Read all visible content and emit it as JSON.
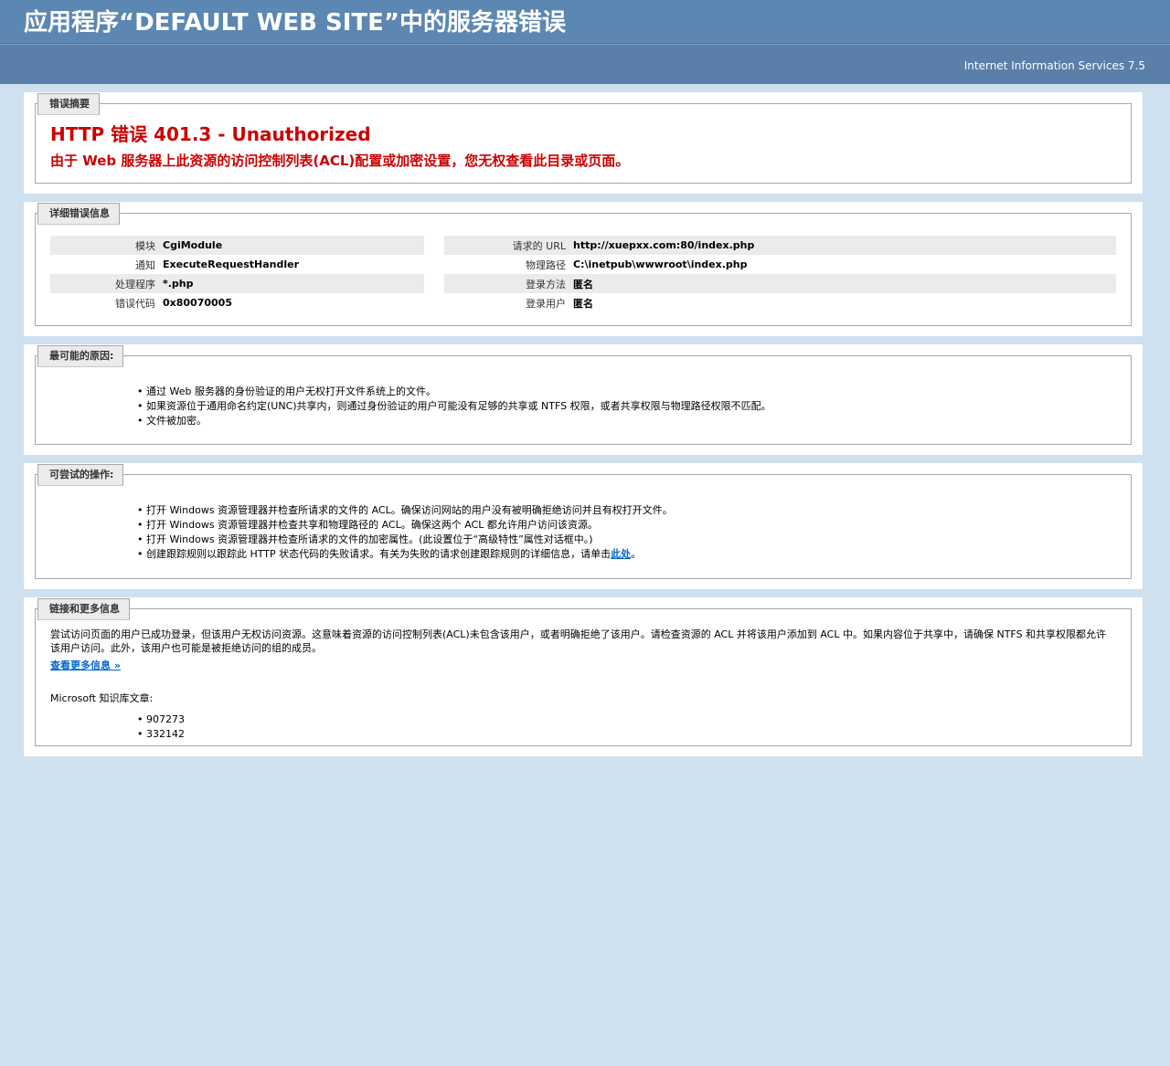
{
  "header": {
    "title": "应用程序“DEFAULT WEB SITE”中的服务器错误",
    "server": "Internet Information Services 7.5"
  },
  "summary": {
    "legend": "错误摘要",
    "title": "HTTP 错误 401.3 - Unauthorized",
    "description": "由于 Web 服务器上此资源的访问控制列表(ACL)配置或加密设置，您无权查看此目录或页面。"
  },
  "details": {
    "legend": "详细错误信息",
    "left": [
      {
        "label": "模块",
        "value": "CgiModule"
      },
      {
        "label": "通知",
        "value": "ExecuteRequestHandler"
      },
      {
        "label": "处理程序",
        "value": "*.php"
      },
      {
        "label": "错误代码",
        "value": "0x80070005"
      }
    ],
    "right": [
      {
        "label": "请求的 URL",
        "value": "http://xuepxx.com:80/index.php"
      },
      {
        "label": "物理路径",
        "value": "C:\\inetpub\\wwwroot\\index.php"
      },
      {
        "label": "登录方法",
        "value": "匿名"
      },
      {
        "label": "登录用户",
        "value": "匿名"
      }
    ]
  },
  "causes": {
    "legend": "最可能的原因:",
    "items": [
      "通过 Web 服务器的身份验证的用户无权打开文件系统上的文件。",
      "如果资源位于通用命名约定(UNC)共享内，则通过身份验证的用户可能没有足够的共享或 NTFS 权限，或者共享权限与物理路径权限不匹配。",
      "文件被加密。"
    ]
  },
  "actions": {
    "legend": "可尝试的操作:",
    "items": [
      "打开 Windows 资源管理器并检查所请求的文件的 ACL。确保访问网站的用户没有被明确拒绝访问并且有权打开文件。",
      "打开 Windows 资源管理器并检查共享和物理路径的 ACL。确保这两个 ACL 都允许用户访问该资源。",
      "打开 Windows 资源管理器并检查所请求的文件的加密属性。(此设置位于“高级特性”属性对话框中。)"
    ],
    "last_item_text": "创建跟踪规则以跟踪此 HTTP 状态代码的失败请求。有关为失败的请求创建跟踪规则的详细信息，请单击",
    "last_item_link": "此处",
    "last_item_end": "。"
  },
  "more_info": {
    "legend": "链接和更多信息",
    "text": "尝试访问页面的用户已成功登录，但该用户无权访问资源。这意味着资源的访问控制列表(ACL)未包含该用户，或者明确拒绝了该用户。请检查资源的 ACL 并将该用户添加到 ACL 中。如果内容位于共享中，请确保 NTFS 和共享权限都允许该用户访问。此外，该用户也可能是被拒绝访问的组的成员。",
    "link": "查看更多信息 »",
    "kb_label": "Microsoft 知识库文章:",
    "kb_items": [
      "907273",
      "332142"
    ]
  },
  "colors": {
    "background": "#cfe0ee",
    "header": "#5c87b2",
    "error_red": "#cc0000",
    "link": "#0066cc"
  }
}
